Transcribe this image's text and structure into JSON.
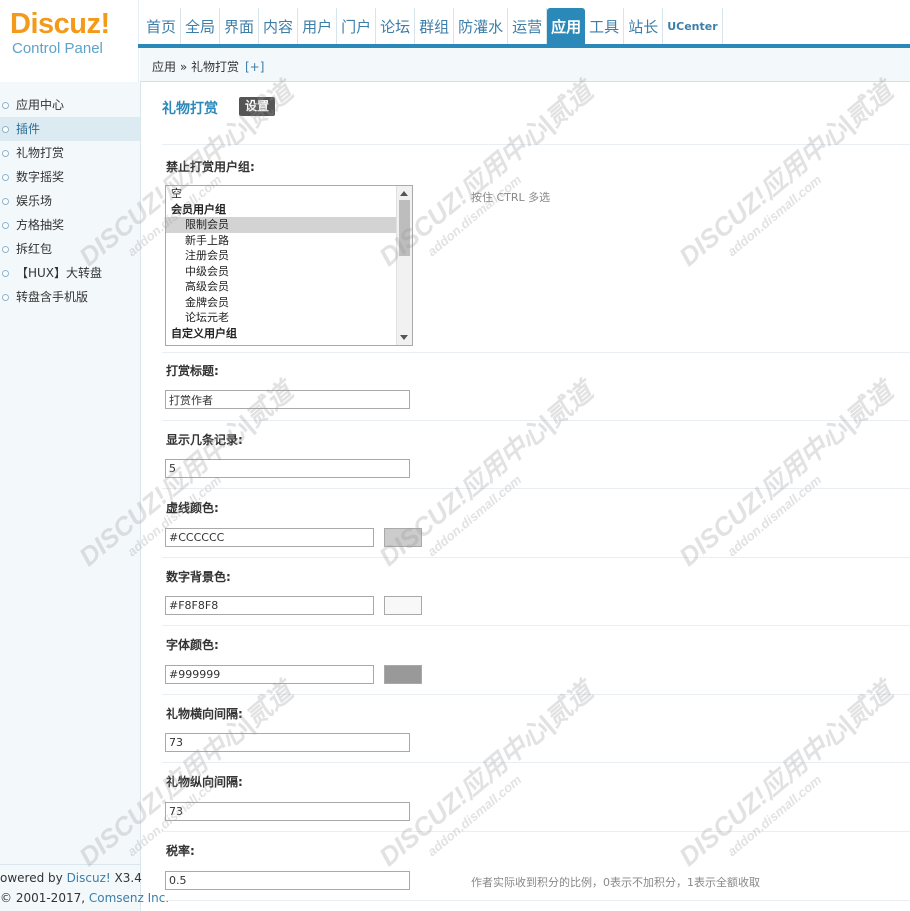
{
  "logo": {
    "brand": "Discuz!",
    "subtitle": "Control Panel"
  },
  "topnav": [
    {
      "label": "首页"
    },
    {
      "label": "全局"
    },
    {
      "label": "界面"
    },
    {
      "label": "内容"
    },
    {
      "label": "用户"
    },
    {
      "label": "门户"
    },
    {
      "label": "论坛"
    },
    {
      "label": "群组"
    },
    {
      "label": "防灌水"
    },
    {
      "label": "运营"
    },
    {
      "label": "应用",
      "active": true
    },
    {
      "label": "工具"
    },
    {
      "label": "站长"
    },
    {
      "label": "UCenter"
    }
  ],
  "breadcrumb": {
    "text": "应用 » 礼物打赏",
    "add": "[+]"
  },
  "sidebar": {
    "items": [
      {
        "label": "应用中心"
      },
      {
        "label": "插件",
        "active": true
      },
      {
        "label": "礼物打赏"
      },
      {
        "label": "数字摇奖"
      },
      {
        "label": "娱乐场"
      },
      {
        "label": "方格抽奖"
      },
      {
        "label": "拆红包"
      },
      {
        "label": "【HUX】大转盘"
      },
      {
        "label": "转盘含手机版"
      }
    ],
    "footer": {
      "powered_prefix": "owered by ",
      "powered_link": "Discuz!",
      "version": " X3.4",
      "copyright_prefix": "© 2001-2017, ",
      "copyright_link": "Comsenz Inc."
    }
  },
  "main": {
    "title": "礼物打赏",
    "tab": "设置",
    "fields": {
      "banned_groups": {
        "label": "禁止打赏用户组:",
        "hint": "按住 CTRL 多选",
        "options": [
          {
            "text": "空",
            "kind": "plain"
          },
          {
            "text": "会员用户组",
            "kind": "group"
          },
          {
            "text": "限制会员",
            "kind": "child",
            "selected": true
          },
          {
            "text": "新手上路",
            "kind": "child"
          },
          {
            "text": "注册会员",
            "kind": "child"
          },
          {
            "text": "中级会员",
            "kind": "child"
          },
          {
            "text": "高级会员",
            "kind": "child"
          },
          {
            "text": "金牌会员",
            "kind": "child"
          },
          {
            "text": "论坛元老",
            "kind": "child"
          },
          {
            "text": "自定义用户组",
            "kind": "group"
          }
        ]
      },
      "reward_title": {
        "label": "打赏标题:",
        "value": "打赏作者"
      },
      "record_count": {
        "label": "显示几条记录:",
        "value": "5"
      },
      "dash_color": {
        "label": "虚线颜色:",
        "value": "#CCCCCC",
        "swatch": "#cccccc"
      },
      "digit_bg": {
        "label": "数字背景色:",
        "value": "#F8F8F8",
        "swatch": "#f8f8f8"
      },
      "font_color": {
        "label": "字体颜色:",
        "value": "#999999",
        "swatch": "#999999"
      },
      "h_spacing": {
        "label": "礼物横向间隔:",
        "value": "73"
      },
      "v_spacing": {
        "label": "礼物纵向间隔:",
        "value": "73"
      },
      "tax_rate": {
        "label": "税率:",
        "value": "0.5",
        "hint": "作者实际收到积分的比例，0表示不加积分，1表示全额收取"
      }
    }
  },
  "watermark": {
    "brand": "DISCUZ!应用中心|贰道",
    "url": "addon.dismall.com"
  },
  "colors": {
    "accent": "#2b89b9",
    "logo": "#f39a1b"
  }
}
